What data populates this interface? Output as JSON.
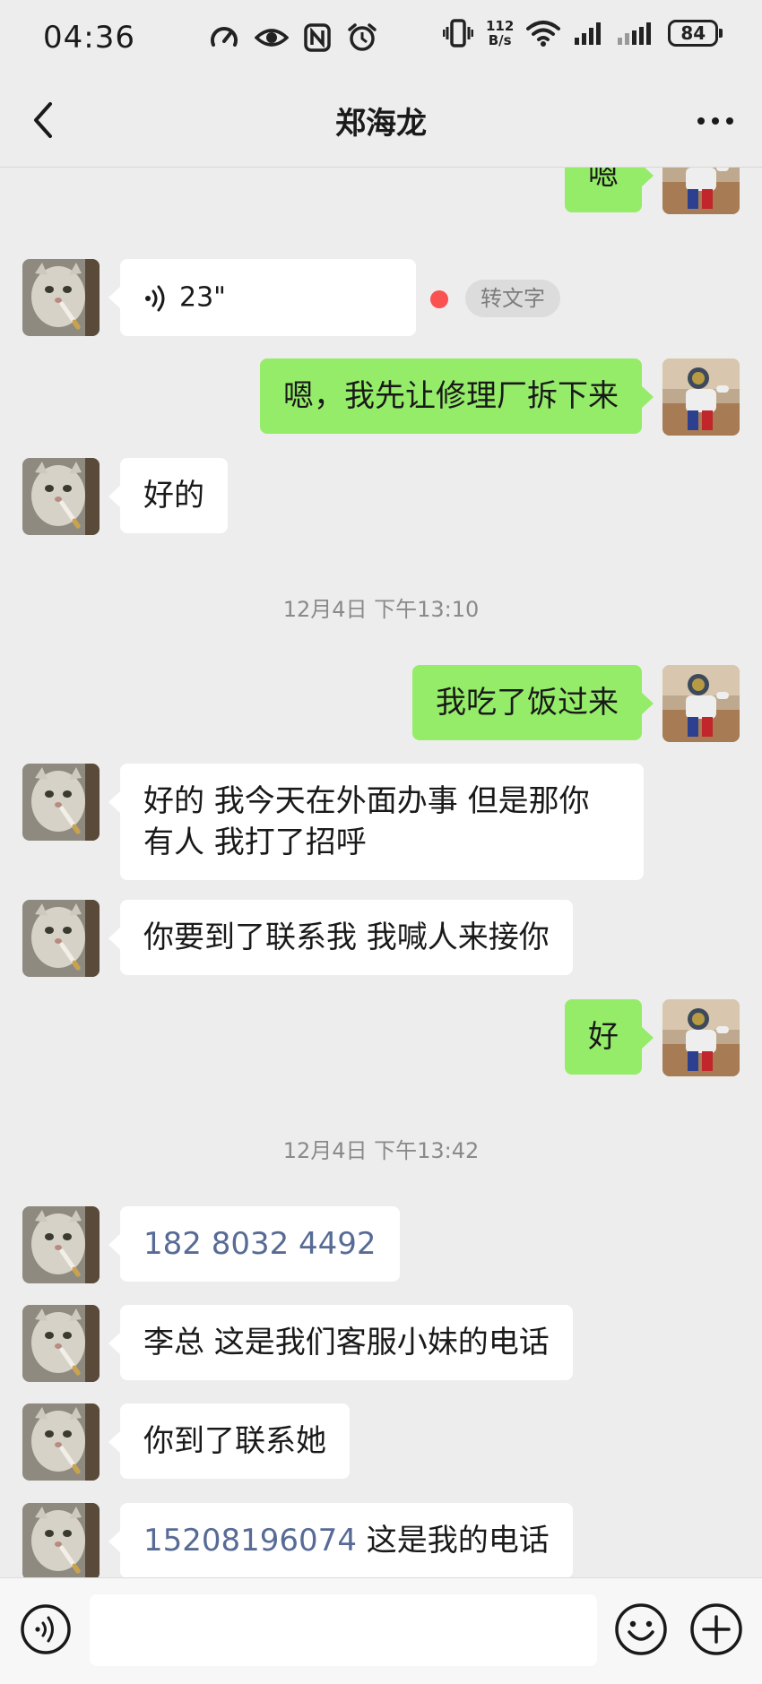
{
  "status_bar": {
    "time": "04:36",
    "net_speed_value": "112",
    "net_speed_unit": "B/s",
    "battery": "84",
    "icons_left": [
      "speedometer-icon",
      "eye-icon",
      "nfc-icon",
      "alarm-icon"
    ],
    "icons_right": [
      "vibrate-icon",
      "wifi-icon",
      "signal-icon",
      "signal-2-icon"
    ]
  },
  "header": {
    "title": "郑海龙",
    "back_icon": "chevron-left-icon",
    "more_icon": "more-icon"
  },
  "messages": [
    {
      "side": "out",
      "text": "嗯"
    },
    {
      "side": "in",
      "type": "voice",
      "duration": "23\"",
      "unread": true,
      "to_text_label": "转文字"
    },
    {
      "side": "out",
      "text": "嗯，我先让修理厂拆下来"
    },
    {
      "side": "in",
      "text": "好的"
    },
    {
      "type": "time",
      "text": "12月4日 下午13:10"
    },
    {
      "side": "out",
      "text": "我吃了饭过来"
    },
    {
      "side": "in",
      "lines": [
        "好的 我今天在外面办事 但是那你",
        "有人 我打了招呼"
      ]
    },
    {
      "side": "in",
      "text": "你要到了联系我 我喊人来接你"
    },
    {
      "side": "out",
      "text": "好"
    },
    {
      "type": "time",
      "text": "12月4日 下午13:42"
    },
    {
      "side": "in",
      "link": "182 8032 4492"
    },
    {
      "side": "in",
      "text": "李总 这是我们客服小妹的电话"
    },
    {
      "side": "in",
      "text": "你到了联系她"
    },
    {
      "side": "in",
      "link": "15208196074",
      "text": " 这是我的电话"
    }
  ],
  "input_bar": {
    "placeholder": "",
    "voice_icon": "voice-input-icon",
    "emoji_icon": "emoji-icon",
    "plus_icon": "plus-icon"
  },
  "colors": {
    "background": "#ededed",
    "incoming_bubble": "#ffffff",
    "outgoing_bubble": "#95ec69",
    "link": "#576b95",
    "unread_dot": "#fa5151"
  }
}
